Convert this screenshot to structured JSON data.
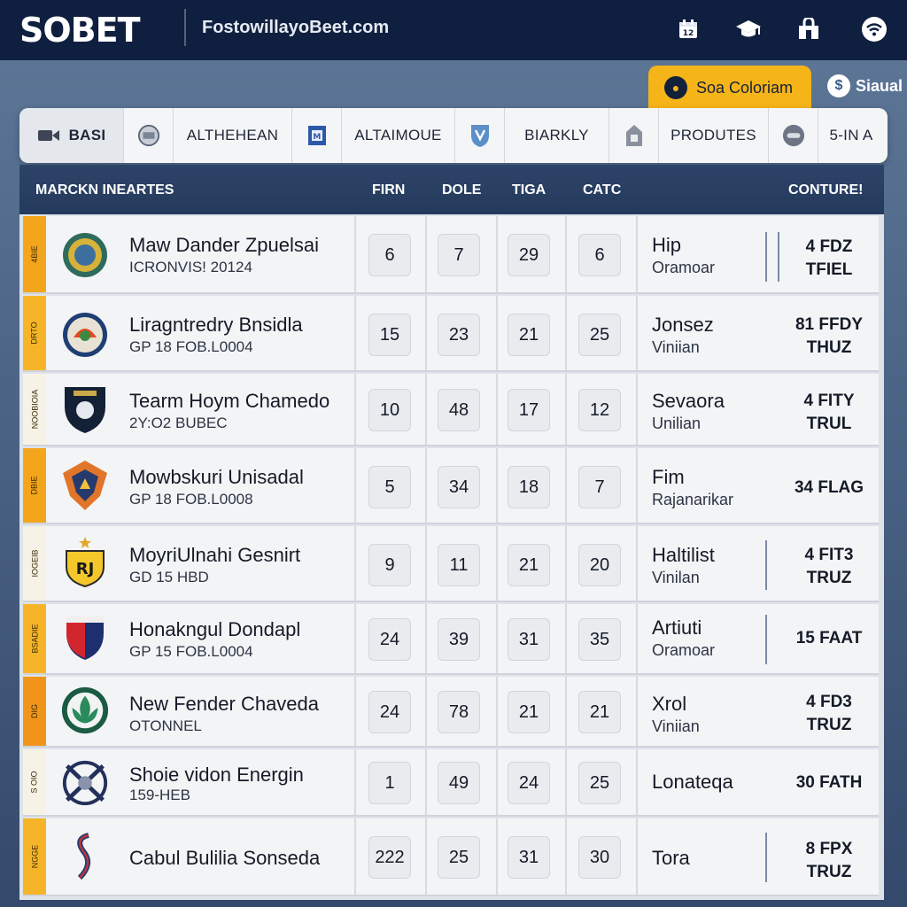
{
  "header": {
    "logo": "SOBET",
    "site": "FostowillayoBeet.com",
    "icons": [
      "calendar-icon",
      "graduation-cap-icon",
      "store-icon",
      "wifi-icon"
    ]
  },
  "pills": {
    "primary": "Soa Coloriam",
    "secondary": "Siaual"
  },
  "tabs": [
    {
      "label": "BASI",
      "icon": "video-icon"
    },
    {
      "label": "",
      "icon": "ball-badge-icon"
    },
    {
      "label": "ALTHEHEAN",
      "icon": ""
    },
    {
      "label": "",
      "icon": "shield-badge-icon"
    },
    {
      "label": "ALTAIMOUE",
      "icon": ""
    },
    {
      "label": "",
      "icon": "crest-badge-icon"
    },
    {
      "label": "BIARKLY",
      "icon": ""
    },
    {
      "label": "",
      "icon": "lantern-badge-icon"
    },
    {
      "label": "PRODUTES",
      "icon": ""
    },
    {
      "label": "",
      "icon": "toggle-badge-icon"
    },
    {
      "label": "5-IN A",
      "icon": ""
    }
  ],
  "table": {
    "headers": {
      "team": "MARCKN INEARTES",
      "c1": "FIRN",
      "c2": "DOLE",
      "c3": "TIGA",
      "c4": "CATC",
      "c5": "CONTURE!"
    },
    "rows": [
      {
        "stripe": "4BIE",
        "name": "Maw Dander Zpuelsai",
        "sub": "ICRONVIS! 20124",
        "v": [
          "6",
          "7",
          "29",
          "6"
        ],
        "who": "Hip",
        "who_sub": "Oramoar",
        "cont1": "4 FDZ",
        "cont2": "TFIEL"
      },
      {
        "stripe": "DRTO",
        "name": "Liragntredry Bnsidla",
        "sub": "GP 18 FOB.L0004",
        "v": [
          "15",
          "23",
          "21",
          "25"
        ],
        "who": "Jonsez",
        "who_sub": "Viniian",
        "cont1": "81 FFDY",
        "cont2": "THUZ"
      },
      {
        "stripe": "NOOBIOIA",
        "name": "Tearm Hoym Chamedo",
        "sub": "2Y:O2 BUBEC",
        "v": [
          "10",
          "48",
          "17",
          "12"
        ],
        "who": "Sevaora",
        "who_sub": "Unilian",
        "cont1": "4 FITY",
        "cont2": "TRUL"
      },
      {
        "stripe": "DBIE",
        "name": "Mowbskuri Unisadal",
        "sub": "GP 18 FOB.L0008",
        "v": [
          "5",
          "34",
          "18",
          "7"
        ],
        "who": "Fim",
        "who_sub": "Rajanarikar",
        "cont1": "34 FLAG",
        "cont2": ""
      },
      {
        "stripe": "IOGEIB",
        "name": "MoyriUlnahi Gesnirt",
        "sub": "GD 15 HBD",
        "v": [
          "9",
          "11",
          "21",
          "20"
        ],
        "who": "Haltilist",
        "who_sub": "Vinilan",
        "cont1": "4 FIT3",
        "cont2": "TRUZ"
      },
      {
        "stripe": "BSADIE",
        "name": "Honakngul Dondapl",
        "sub": "GP 15 FOB.L0004",
        "v": [
          "24",
          "39",
          "31",
          "35"
        ],
        "who": "Artiuti",
        "who_sub": "Oramoar",
        "cont1": "15 FAAT",
        "cont2": ""
      },
      {
        "stripe": "DIG",
        "name": "New Fender Chaveda",
        "sub": "OTONNEL",
        "v": [
          "24",
          "78",
          "21",
          "21"
        ],
        "who": "Xrol",
        "who_sub": "Viniian",
        "cont1": "4 FD3",
        "cont2": "TRUZ"
      },
      {
        "stripe": "S OIO",
        "name": "Shoie vidon Energin",
        "sub": "159-HEB",
        "v": [
          "1",
          "49",
          "24",
          "25"
        ],
        "who": "Lonateqa",
        "who_sub": "",
        "cont1": "30 FATH",
        "cont2": ""
      },
      {
        "stripe": "NGGE",
        "name": "Cabul Bulilia Sonseda",
        "sub": "",
        "v": [
          "222",
          "25",
          "31",
          "30"
        ],
        "who": "Tora",
        "who_sub": "",
        "cont1": "8 FPX",
        "cont2": "TRUZ"
      }
    ]
  }
}
